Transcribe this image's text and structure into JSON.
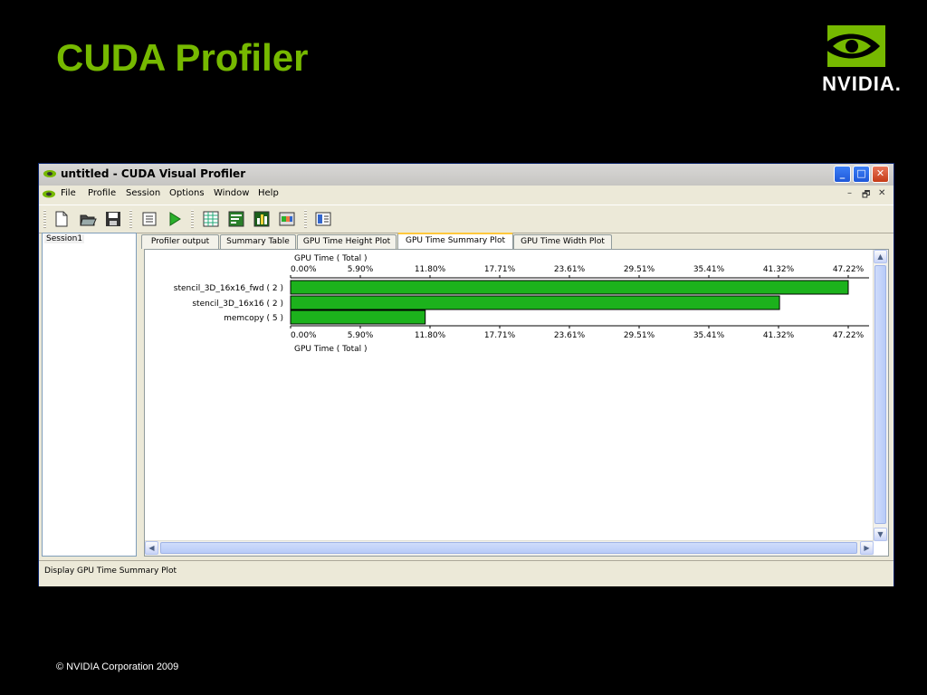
{
  "slide": {
    "title": "CUDA Profiler",
    "logo_text": "NVIDIA.",
    "copyright": "© NVIDIA Corporation 2009"
  },
  "window": {
    "title": "untitled - CUDA Visual Profiler",
    "controls": {
      "minimize": "_",
      "maximize": "□",
      "close": "✕"
    }
  },
  "menu": {
    "items": [
      "File",
      "Profile",
      "Session",
      "Options",
      "Window",
      "Help"
    ],
    "mdi_controls": [
      "–",
      "🗗",
      "✕"
    ]
  },
  "toolbar": {
    "buttons": [
      "new-icon",
      "open-icon",
      "save-icon",
      "session-icon",
      "run-icon",
      "table-icon",
      "summary-table-icon",
      "bar-plot-icon",
      "width-plot-icon",
      "details-icon"
    ]
  },
  "sidebar": {
    "session": "Session1"
  },
  "tabs": [
    {
      "label": "Profiler output",
      "active": false
    },
    {
      "label": "Summary Table",
      "active": false
    },
    {
      "label": "GPU Time Height Plot",
      "active": false
    },
    {
      "label": "GPU Time Summary Plot",
      "active": true
    },
    {
      "label": "GPU Time Width Plot",
      "active": false
    }
  ],
  "status": {
    "text": "Display GPU Time Summary Plot"
  },
  "colors": {
    "title_green": "#76b900",
    "bar_green": "#1cb21c"
  },
  "chart_data": {
    "type": "bar",
    "orientation": "horizontal",
    "xlabel": "GPU Time ( Total )",
    "ticks": [
      "0.00%",
      "5.90%",
      "11.80%",
      "17.71%",
      "23.61%",
      "29.51%",
      "35.41%",
      "41.32%",
      "47.22%"
    ],
    "xlim": [
      0,
      47.22
    ],
    "categories": [
      "stencil_3D_16x16_fwd ( 2 )",
      "stencil_3D_16x16 ( 2 )",
      "memcopy ( 5 )"
    ],
    "values": [
      47.22,
      41.4,
      11.4
    ]
  }
}
